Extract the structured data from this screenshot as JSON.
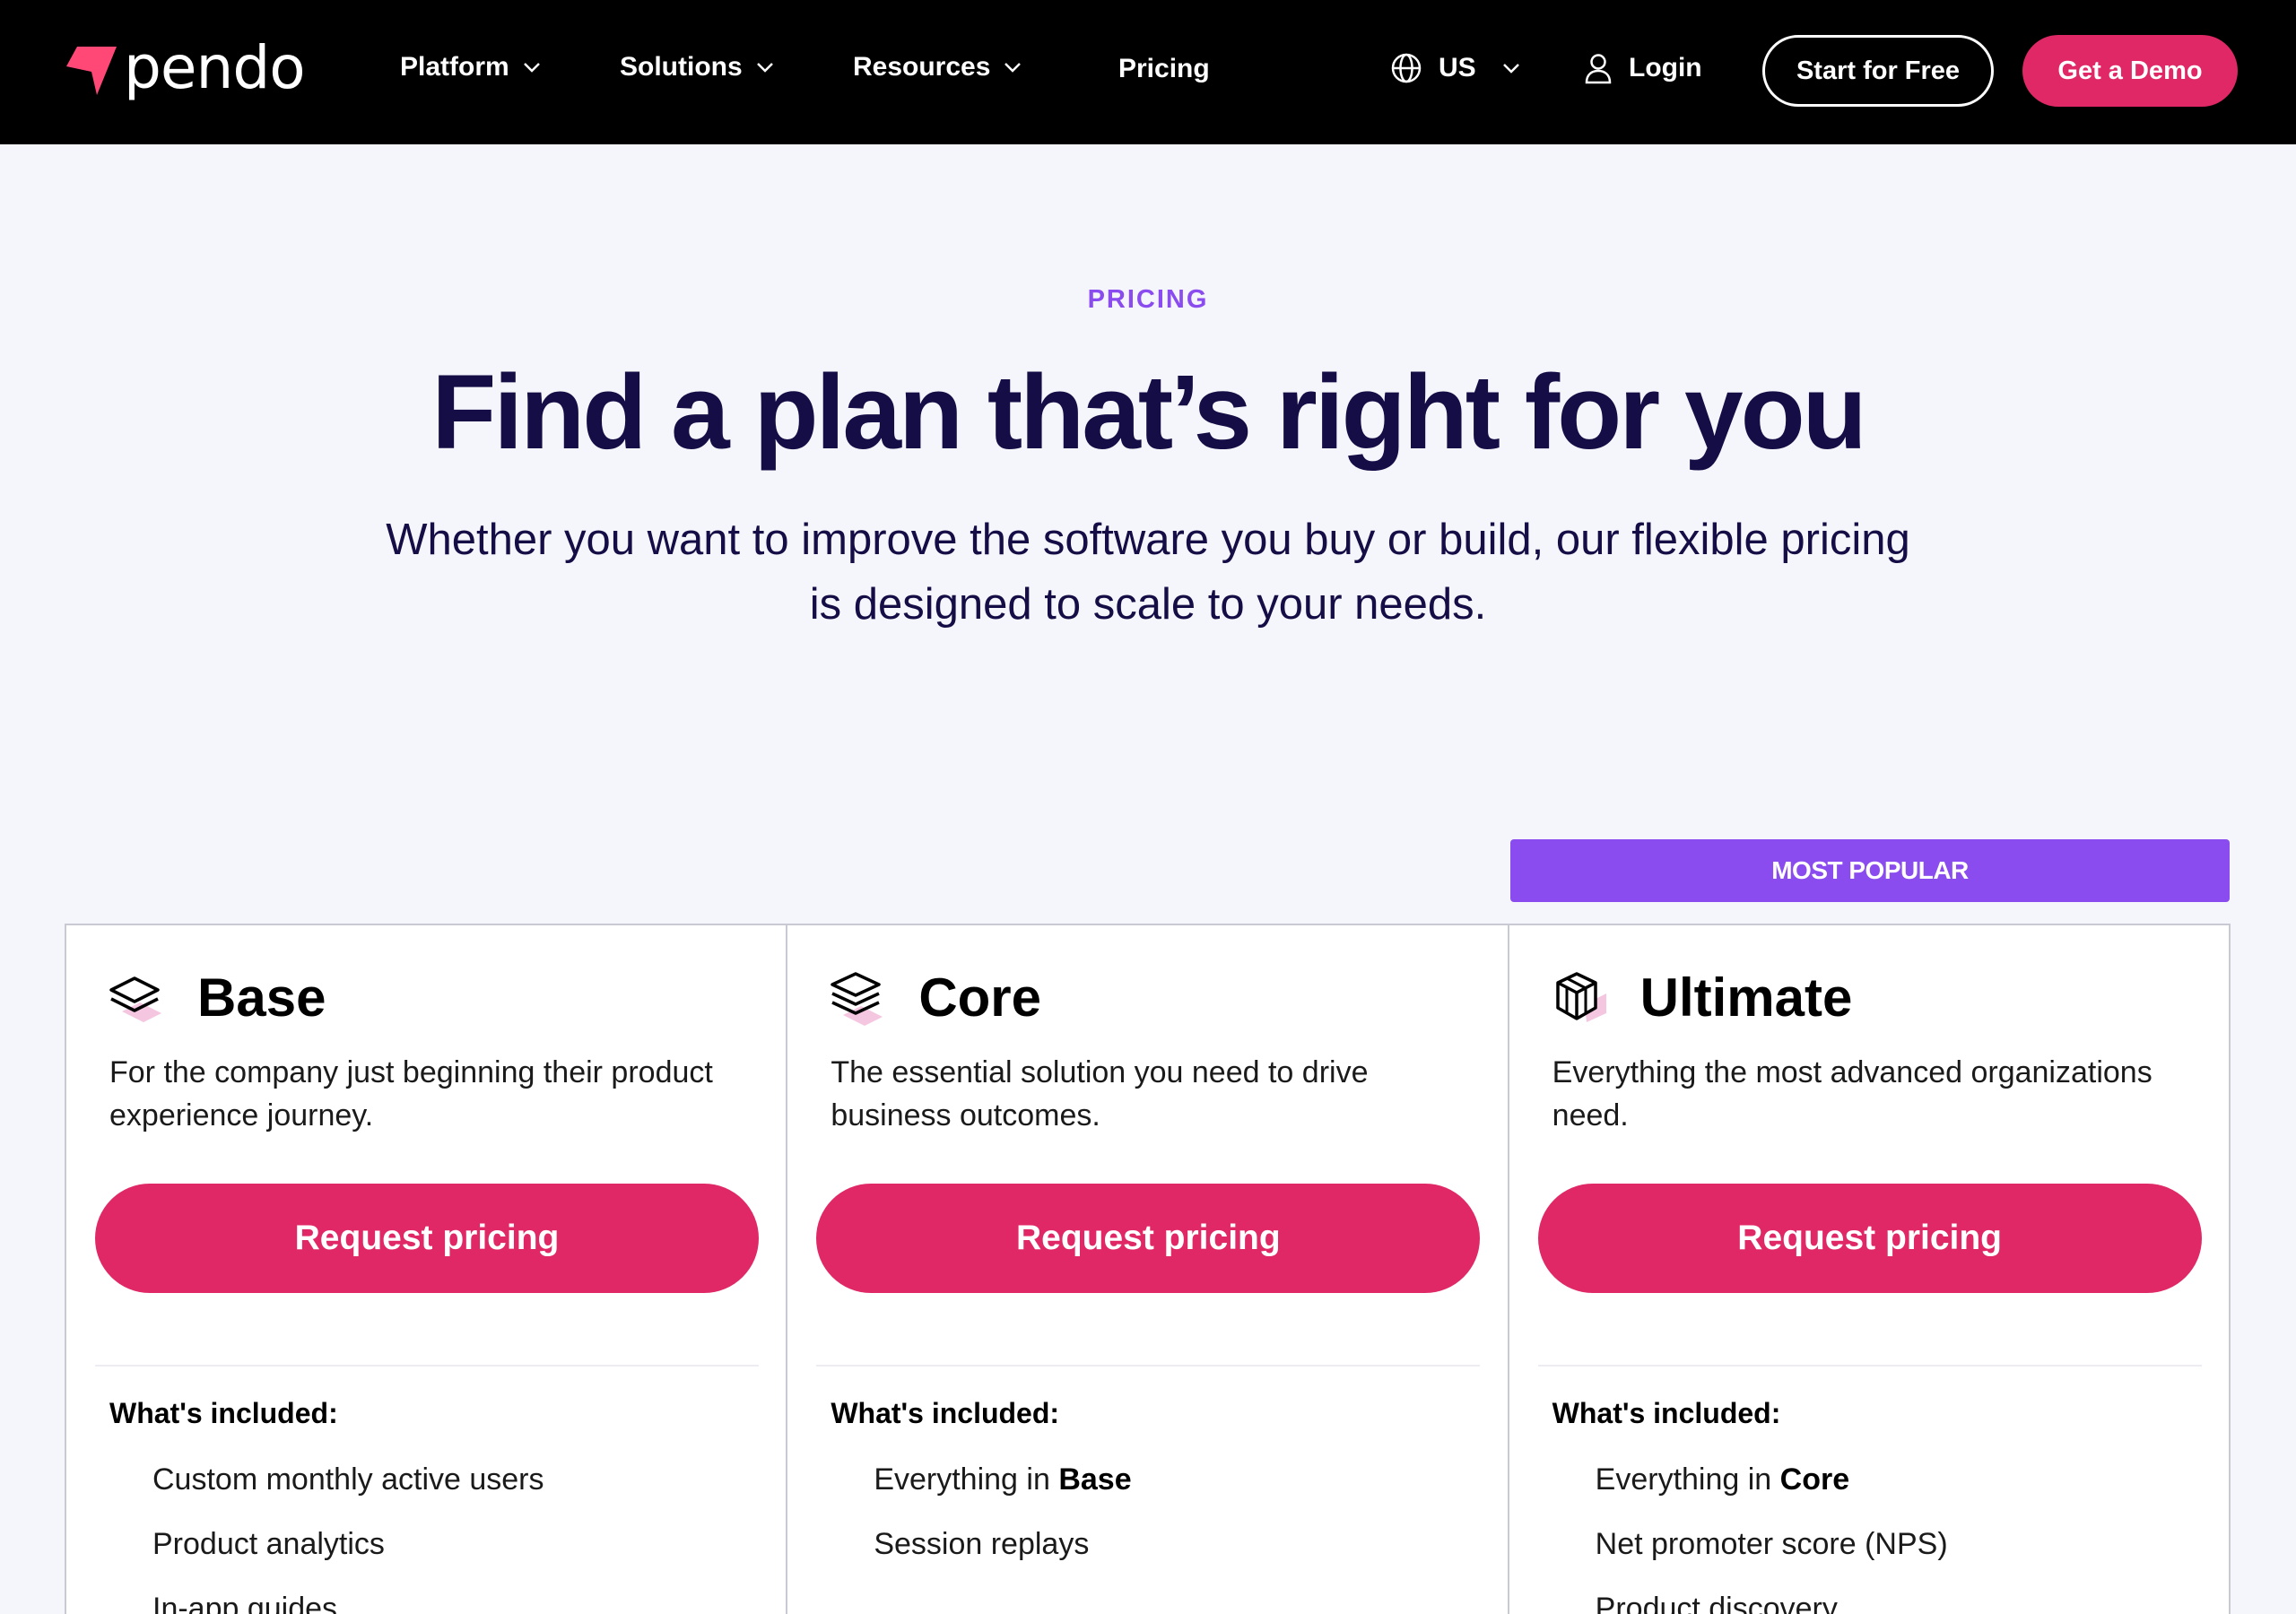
{
  "nav": {
    "logo_text": "pendo",
    "brand_color": "#ff4876",
    "items": [
      {
        "label": "Platform",
        "has_dropdown": true
      },
      {
        "label": "Solutions",
        "has_dropdown": true
      },
      {
        "label": "Resources",
        "has_dropdown": true
      },
      {
        "label": "Pricing",
        "has_dropdown": false
      }
    ],
    "region": "US",
    "login": "Login",
    "start_free": "Start for Free",
    "get_demo": "Get a Demo"
  },
  "hero": {
    "eyebrow": "PRICING",
    "title": "Find a plan that’s right for you",
    "subtitle": "Whether you want to improve the software you buy or build, our flexible pricing is designed to scale to your needs."
  },
  "popular_badge": "MOST POPULAR",
  "plans": [
    {
      "name": "Base",
      "icon": "layers-icon",
      "description": "For the company just beginning their product experience journey.",
      "cta": "Request pricing",
      "included_label": "What's included:",
      "features": [
        {
          "text": "Custom monthly active users",
          "emphasis": ""
        },
        {
          "text": "Product analytics",
          "emphasis": ""
        },
        {
          "text": "In-app guides",
          "emphasis": ""
        }
      ]
    },
    {
      "name": "Core",
      "icon": "stacked-layers-icon",
      "description": "The essential solution you need to drive business outcomes.",
      "cta": "Request pricing",
      "included_label": "What's included:",
      "features": [
        {
          "text": "Everything in ",
          "emphasis": "Base"
        },
        {
          "text": "Session replays",
          "emphasis": ""
        }
      ]
    },
    {
      "name": "Ultimate",
      "icon": "cube-icon",
      "description": "Everything the most advanced organizations need.",
      "cta": "Request pricing",
      "included_label": "What's included:",
      "features": [
        {
          "text": "Everything in ",
          "emphasis": "Core"
        },
        {
          "text": "Net promoter score (NPS)",
          "emphasis": ""
        },
        {
          "text": "Product discovery",
          "emphasis": ""
        }
      ]
    }
  ],
  "colors": {
    "nav_bg": "#000000",
    "accent_pink": "#e02866",
    "accent_purple": "#8a4bef",
    "heading": "#150d45",
    "page_bg": "#f5f5fc"
  }
}
